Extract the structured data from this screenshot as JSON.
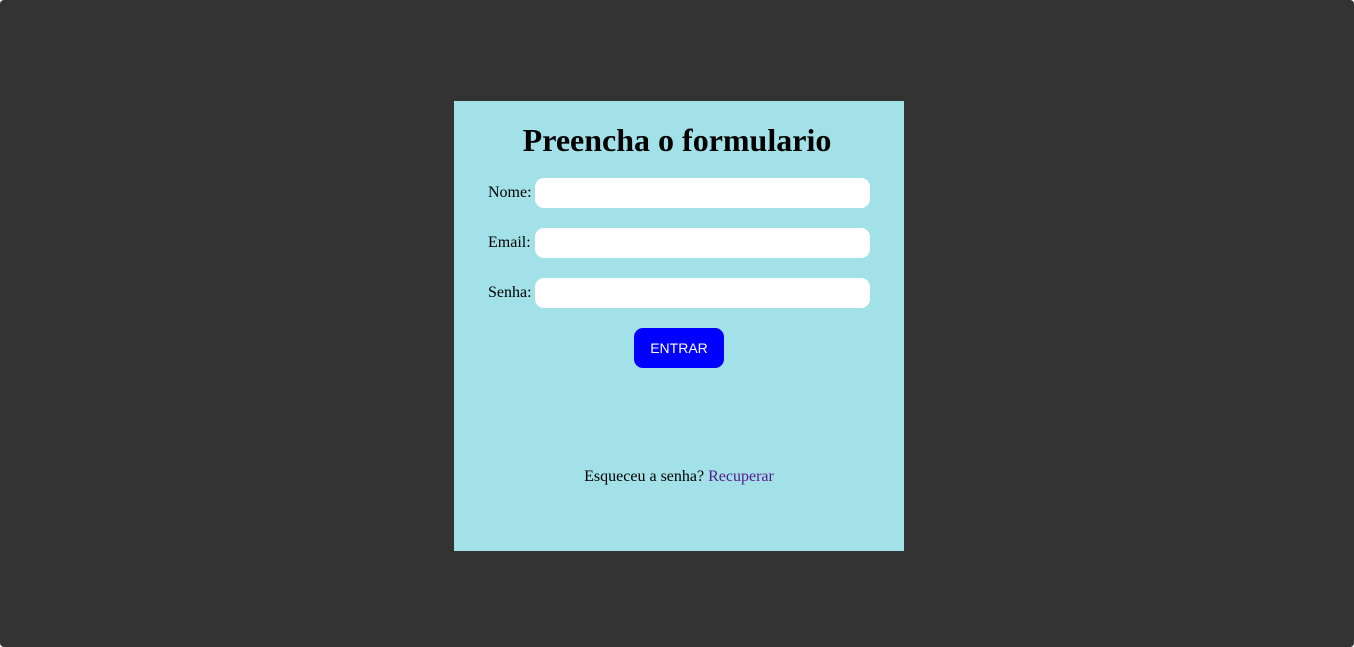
{
  "form": {
    "title": "Preencha o formulario",
    "fields": [
      {
        "label": "Nome:",
        "value": "",
        "placeholder": ""
      },
      {
        "label": "Email:",
        "value": "",
        "placeholder": ""
      },
      {
        "label": "Senha:",
        "value": "",
        "placeholder": ""
      }
    ],
    "submit_label": "ENTRAR",
    "forgot_text": "Esqueceu a senha?",
    "recover_link": "Recuperar"
  },
  "colors": {
    "page_background": "#333333",
    "card_background": "#a2e1e7",
    "button_background": "#0000ff",
    "button_text": "#ffffff",
    "link_visited": "#551a8b"
  }
}
